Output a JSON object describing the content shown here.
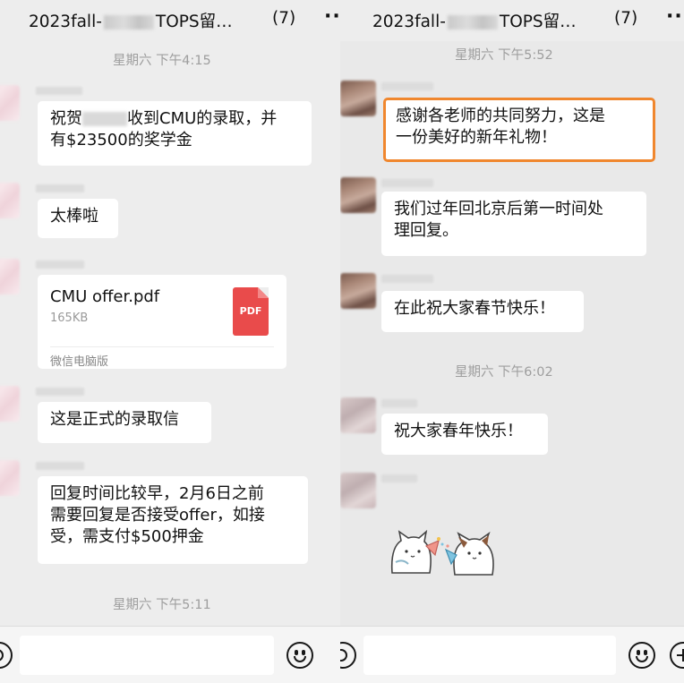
{
  "left": {
    "header": {
      "title_prefix": "2023fall-",
      "title_suffix": "TOPS留…",
      "count": "(7)",
      "more": "··"
    },
    "timestamps": [
      "星期六 下午4:15",
      "星期六 下午5:11"
    ],
    "messages": [
      {
        "type": "text",
        "part1": "祝贺",
        "part2": "收到CMU的录取，并",
        "line2": "有$23500的奖学金"
      },
      {
        "type": "text",
        "text": "太棒啦"
      },
      {
        "type": "file",
        "name": "CMU offer.pdf",
        "size": "165KB",
        "badge": "PDF",
        "source": "微信电脑版"
      },
      {
        "type": "text",
        "text": "这是正式的录取信"
      },
      {
        "type": "text",
        "lines": [
          "回复时间比较早，2月6日之前",
          "需要回复是否接受offer，如接",
          "受，需支付$500押金"
        ]
      }
    ]
  },
  "right": {
    "header": {
      "title_prefix": "2023fall-",
      "title_suffix": "TOPS留…",
      "count": "(7)",
      "more": "··"
    },
    "timestamps": [
      "星期六 下午5:52",
      "星期六 下午6:02"
    ],
    "messages": [
      {
        "type": "text",
        "lines": [
          "感谢各老师的共同努力，这是",
          "一份美好的新年礼物！"
        ],
        "highlight_color": "#f0872e"
      },
      {
        "type": "text",
        "lines": [
          "我们过年回北京后第一时间处",
          "理回复。"
        ]
      },
      {
        "type": "text",
        "text": "在此祝大家春节快乐！"
      },
      {
        "type": "text",
        "text": "祝大家春年快乐！"
      },
      {
        "type": "sticker",
        "icon": "celebration-cats-sticker"
      }
    ]
  }
}
